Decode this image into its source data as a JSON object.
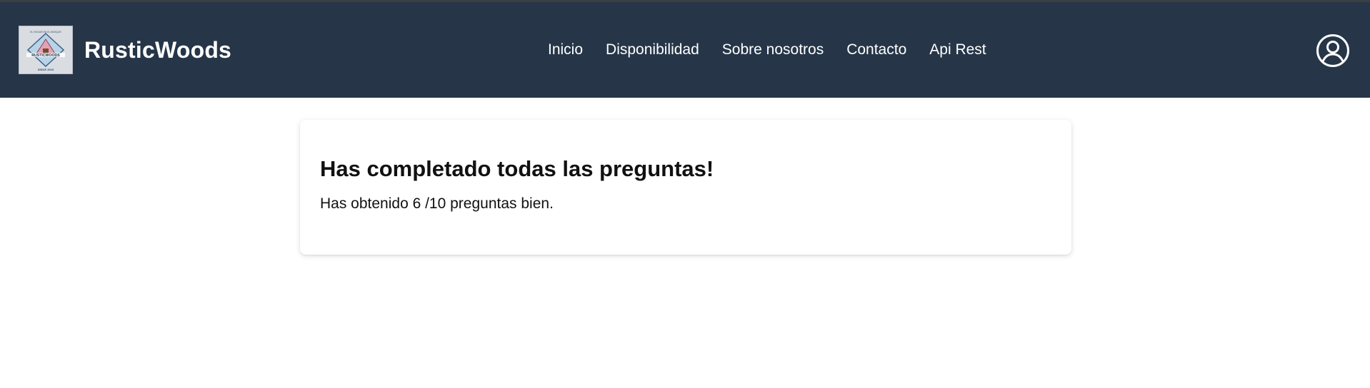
{
  "header": {
    "brand_name": "RusticWoods",
    "logo": {
      "top_text": "EL HOGAR EN EL BOSQUE",
      "name": "RUSTICWOODS",
      "bottom_text": "SINCE 2023"
    },
    "nav": [
      {
        "label": "Inicio"
      },
      {
        "label": "Disponibilidad"
      },
      {
        "label": "Sobre nosotros"
      },
      {
        "label": "Contacto"
      },
      {
        "label": "Api Rest"
      }
    ],
    "user_icon": "user-circle-icon"
  },
  "result": {
    "title": "Has completado todas las preguntas!",
    "message": "Has obtenido 6 /10 preguntas bien."
  },
  "colors": {
    "navbar": "#263648",
    "nav_text": "#ffffff",
    "body_text": "#111111"
  }
}
